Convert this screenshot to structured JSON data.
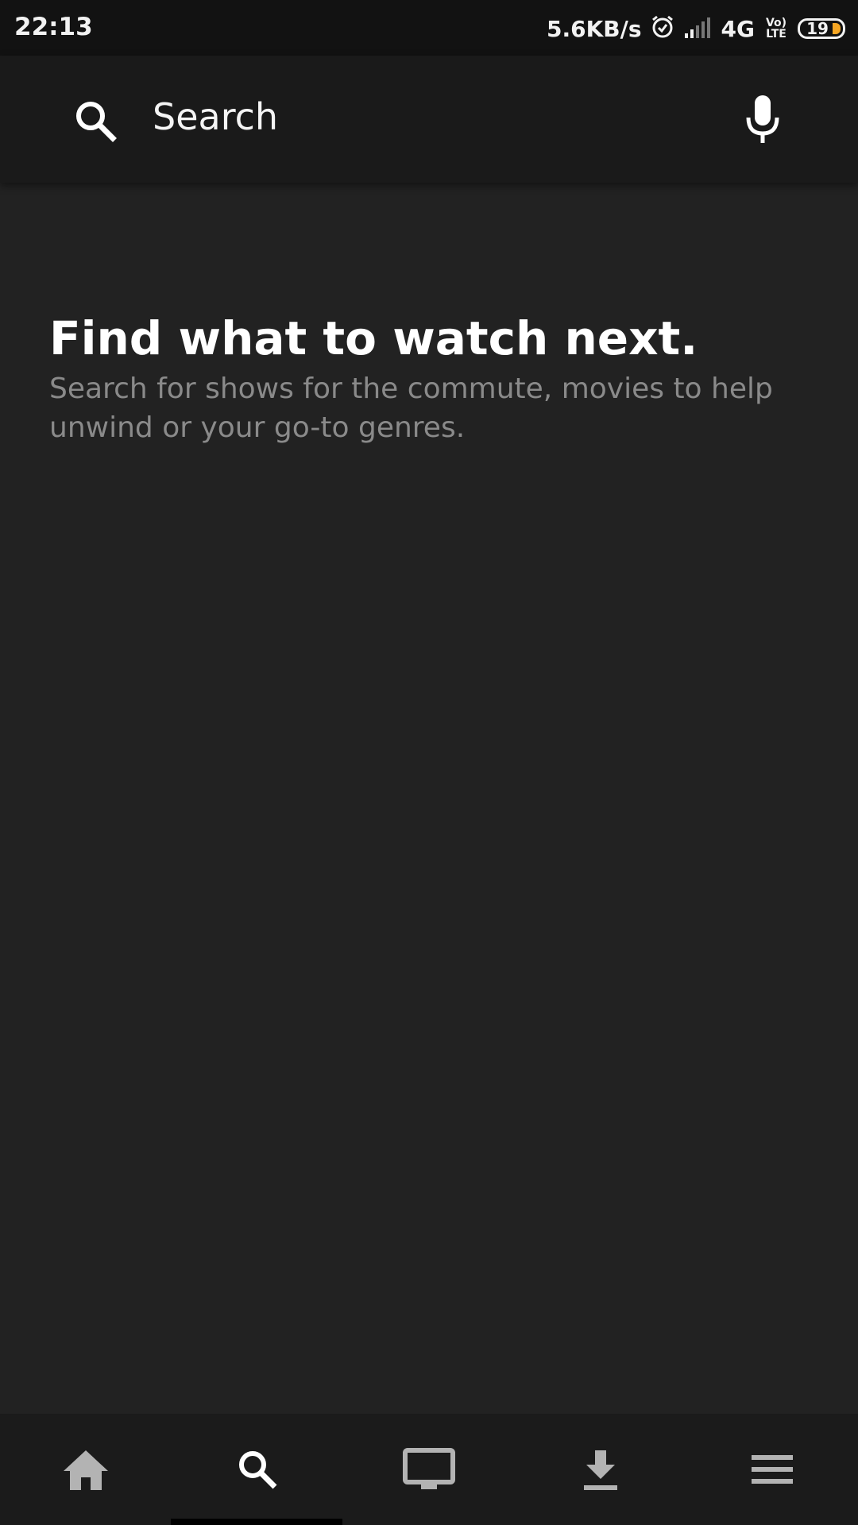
{
  "status_bar": {
    "time": "22:13",
    "net_speed": "5.6KB/s",
    "network": "4G",
    "volte_line1": "Vo)",
    "volte_line2": "LTE",
    "battery": "19",
    "battery_color": "#f5a623"
  },
  "search": {
    "placeholder": "Search",
    "icon": "search-icon",
    "mic_icon": "mic-icon"
  },
  "empty_state": {
    "title": "Find what to watch next.",
    "subtitle": "Search for shows for the commute, movies to help unwind or your go-to genres."
  },
  "bottom_nav": {
    "items": [
      {
        "icon": "home-icon",
        "active": false
      },
      {
        "icon": "search-icon",
        "active": true
      },
      {
        "icon": "tv-icon",
        "active": false
      },
      {
        "icon": "download-icon",
        "active": false
      },
      {
        "icon": "menu-icon",
        "active": false
      }
    ]
  },
  "colors": {
    "background": "#222222",
    "header": "#1a1a1a",
    "nav": "#1b1b1b",
    "inactive_icon": "#b3b3b3",
    "active_icon": "#ffffff"
  }
}
